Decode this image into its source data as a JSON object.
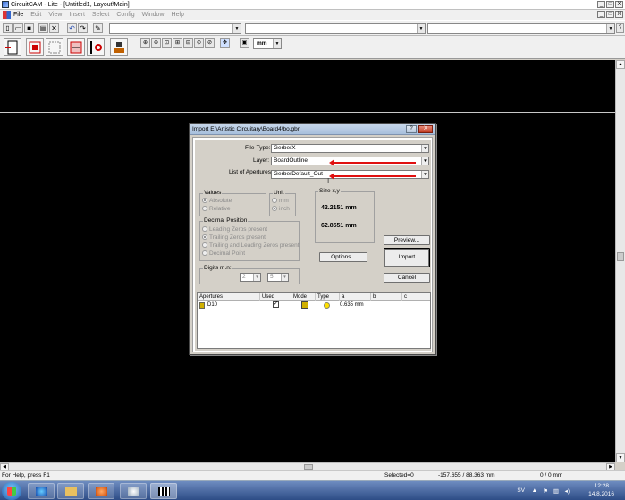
{
  "app": {
    "title": "CircuitCAM - Lite - [Untitled1, Layout\\Main]",
    "minimize": "_",
    "maximize": "□",
    "close": "X"
  },
  "menu": {
    "items": [
      {
        "label": "File",
        "enabled": true
      },
      {
        "label": "Edit",
        "enabled": false
      },
      {
        "label": "View",
        "enabled": false
      },
      {
        "label": "Insert",
        "enabled": false
      },
      {
        "label": "Select",
        "enabled": false
      },
      {
        "label": "Config",
        "enabled": false
      },
      {
        "label": "Window",
        "enabled": false
      },
      {
        "label": "Help",
        "enabled": false
      }
    ]
  },
  "toolbar": {
    "unit": "mm"
  },
  "dialog": {
    "title": "Import   E:\\Artistic Circuitary\\Board4\\bo.gbr",
    "help": "?",
    "close": "X",
    "file_type_label": "File-Type:",
    "file_type_value": "GerberX",
    "layer_label": "Layer:",
    "layer_value": "BoardOutline",
    "apertures_label": "List of Apertures:",
    "apertures_value": "GerberDefault_Out",
    "values_group": "Values",
    "values_options": [
      "Absolute",
      "Relative"
    ],
    "unit_group": "Unit",
    "unit_options": [
      "mm",
      "inch"
    ],
    "size_group": "Size x,y",
    "size_x": "42.2151 mm",
    "size_y": "62.8551 mm",
    "decimal_group": "Decimal Position",
    "decimal_options": [
      "Leading Zeros present",
      "Trailing Zeros present",
      "Trailing and Leading Zeros present",
      "Decimal Point"
    ],
    "digits_group": "Digits m.n:",
    "digits_m": "2",
    "digits_n": "5",
    "options_button": "Options...",
    "preview_button": "Preview...",
    "import_button": "Import",
    "cancel_button": "Cancel",
    "table": {
      "columns": [
        "Apertures",
        "Used",
        "Mode",
        "Type",
        "a",
        "b",
        "c"
      ],
      "rows": [
        {
          "aperture": "D10",
          "used": true,
          "a": "0.635 mm",
          "b": "",
          "c": ""
        }
      ]
    }
  },
  "status": {
    "help": "For Help, press F1",
    "selected": "Selected=0",
    "coords": "-157.655 / 88.363 mm",
    "measure": "0 / 0 mm"
  },
  "taskbar": {
    "lang": "SV",
    "time": "12:28",
    "date": "14.8.2016"
  },
  "colors": {
    "workspace": "#000000",
    "arrow": "#e01010",
    "dialog_bg": "#d4d0c8"
  }
}
